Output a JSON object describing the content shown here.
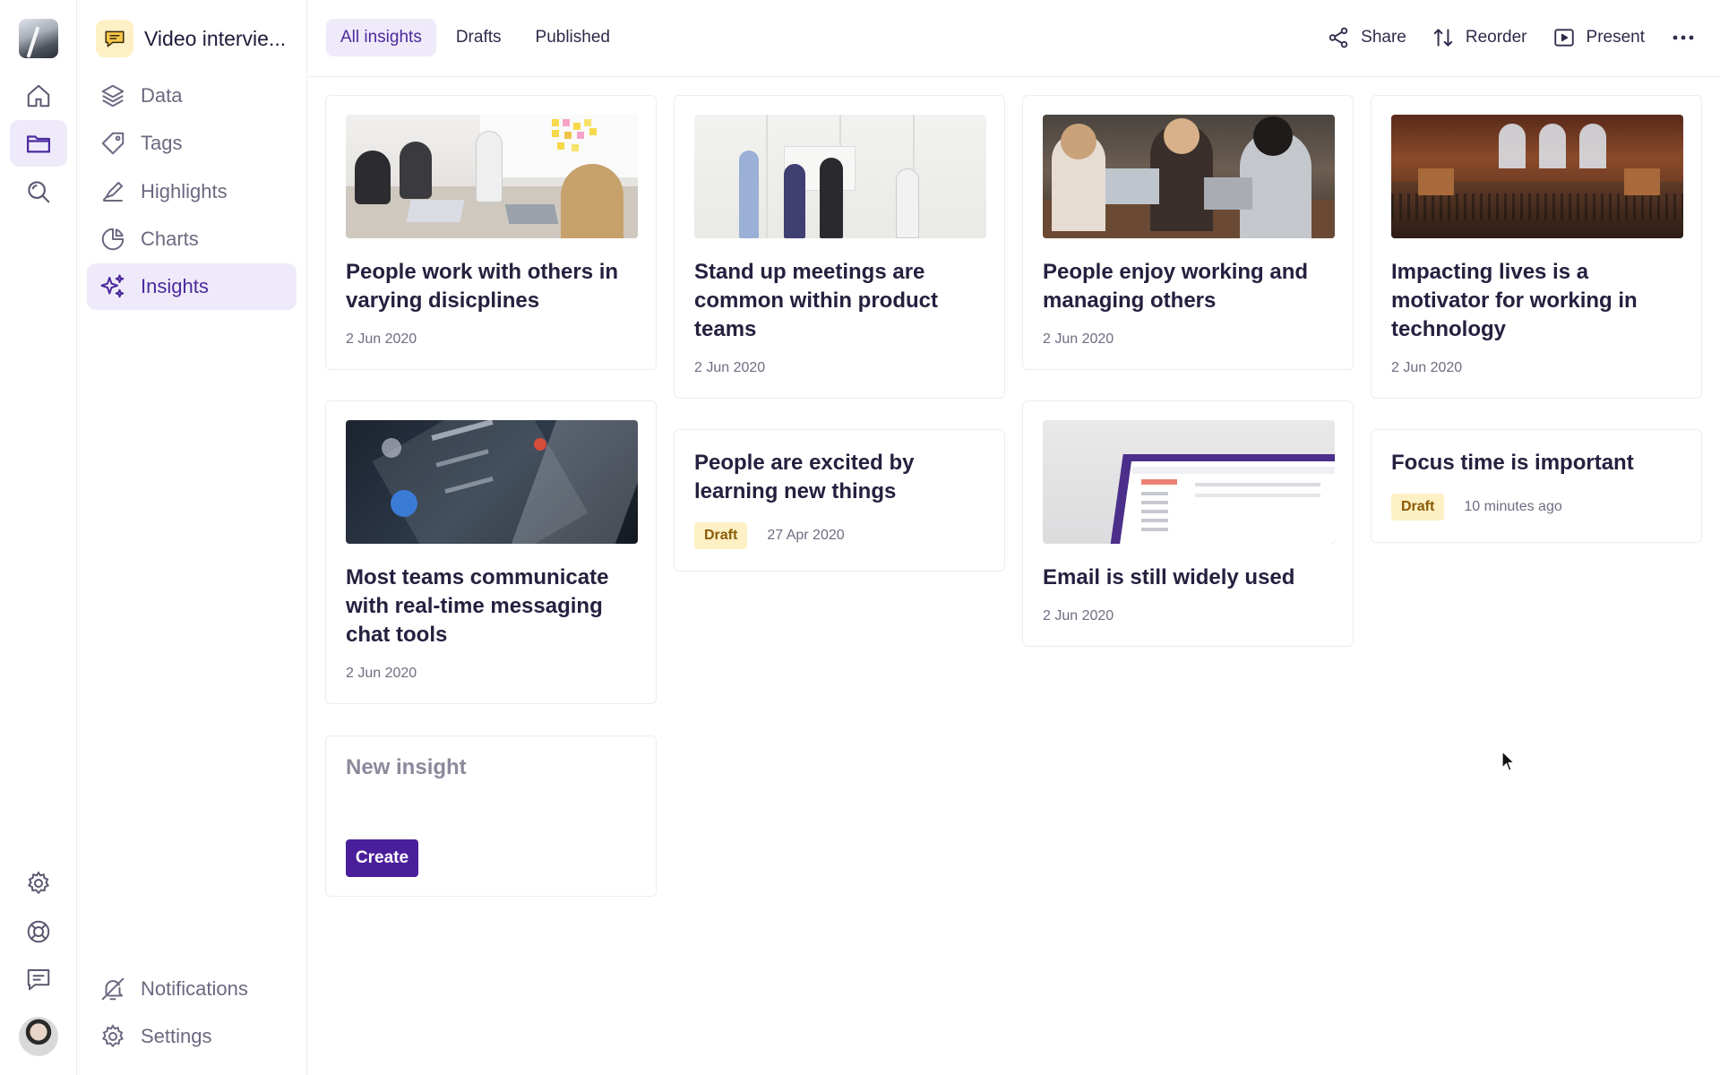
{
  "app": {
    "project_title": "Video intervie..."
  },
  "rail": {
    "items": [
      {
        "icon": "home-icon"
      },
      {
        "icon": "folder-icon",
        "active": true
      },
      {
        "icon": "search-icon"
      },
      {
        "icon": "gear-icon"
      },
      {
        "icon": "help-icon"
      },
      {
        "icon": "feedback-icon"
      }
    ]
  },
  "sidebar": {
    "items": [
      {
        "label": "Data",
        "icon": "layers-icon"
      },
      {
        "label": "Tags",
        "icon": "tag-icon"
      },
      {
        "label": "Highlights",
        "icon": "highlighter-icon"
      },
      {
        "label": "Charts",
        "icon": "pie-chart-icon"
      },
      {
        "label": "Insights",
        "icon": "sparkles-icon",
        "active": true
      }
    ],
    "footer": [
      {
        "label": "Notifications",
        "icon": "bell-off-icon"
      },
      {
        "label": "Settings",
        "icon": "gear-icon"
      }
    ]
  },
  "topbar": {
    "tabs": [
      {
        "label": "All insights",
        "active": true
      },
      {
        "label": "Drafts"
      },
      {
        "label": "Published"
      }
    ],
    "actions": {
      "share": "Share",
      "reorder": "Reorder",
      "present": "Present"
    }
  },
  "insights": [
    {
      "title": "People work with others in varying disicplines",
      "date": "2 Jun 2020"
    },
    {
      "title": "Most teams communicate with real-time messaging chat tools",
      "date": "2 Jun 2020"
    },
    {
      "title": "Stand up meetings are common within product teams",
      "date": "2 Jun 2020"
    },
    {
      "title": "People are excited by learning new things",
      "date": "27 Apr 2020",
      "badge": "Draft"
    },
    {
      "title": "People enjoy working and managing others",
      "date": "2 Jun 2020"
    },
    {
      "title": "Email is still widely used",
      "date": "2 Jun 2020"
    },
    {
      "title": "Impacting lives is a motivator for working in technology",
      "date": "2 Jun 2020"
    },
    {
      "title": "Focus time is important",
      "date": "10 minutes ago",
      "badge": "Draft"
    }
  ],
  "new_insight": {
    "title": "New insight",
    "button": "Create"
  },
  "colors": {
    "accent": "#4a1f9c",
    "active_bg": "#efeaf9",
    "badge_bg": "#fdf0c4",
    "badge_text": "#8a5b06"
  }
}
